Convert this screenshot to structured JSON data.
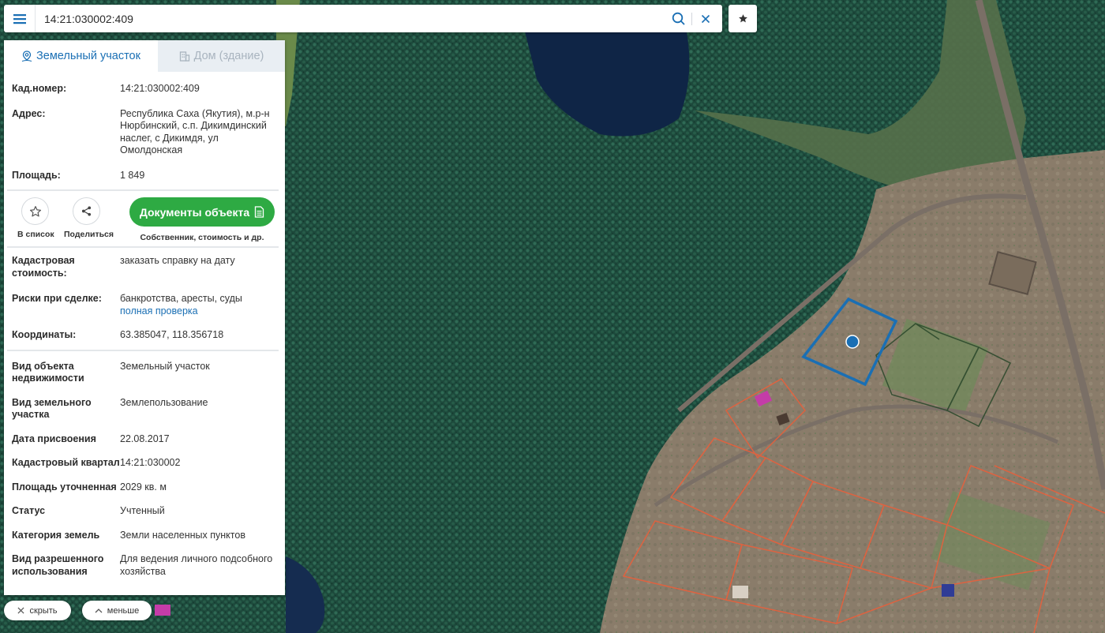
{
  "search": {
    "value": "14:21:030002:409",
    "placeholder": ""
  },
  "icons": {
    "menu": "hamburger-menu-icon",
    "search": "search-icon",
    "clear": "close-icon",
    "favorite": "star-icon",
    "tab_land": "location-pin-icon",
    "tab_house": "building-icon",
    "add_list": "star-outline-icon",
    "share": "share-icon",
    "documents": "document-icon"
  },
  "colors": {
    "accent": "#1a6fb4",
    "green_button": "#2eaa43",
    "parcel_outline": "#1a6fb4",
    "neighbor_outline": "#e8603c"
  },
  "tabs": [
    {
      "label": "Земельный участок",
      "active": true
    },
    {
      "label": "Дом (здание)",
      "active": false
    }
  ],
  "info": {
    "cad_number": {
      "label": "Кад.номер:",
      "value": "14:21:030002:409"
    },
    "address": {
      "label": "Адрес:",
      "value": "Республика Саха (Якутия), м.р-н Нюрбинский, с.п. Дикимдинский наслег, с Дикимдя, ул Омолдонская"
    },
    "area": {
      "label": "Площадь:",
      "value": "1 849"
    }
  },
  "actions": {
    "add_list": "В список",
    "share": "Поделиться",
    "documents": "Документы объекта",
    "documents_sub": "Собственник, стоимость и др."
  },
  "details": {
    "cad_cost": {
      "label": "Кадастровая стоимость:",
      "value": "заказать справку на дату"
    },
    "risks": {
      "label": "Риски при сделке:",
      "value": "банкротства, аресты, суды",
      "link": "полная проверка"
    },
    "coords": {
      "label": "Координаты:",
      "value": "63.385047, 118.356718"
    }
  },
  "properties": [
    {
      "label": "Вид объекта недвижимости",
      "value": "Земельный участок"
    },
    {
      "label": "Вид земельного участка",
      "value": "Землепользование"
    },
    {
      "label": "Дата присвоения",
      "value": "22.08.2017"
    },
    {
      "label": "Кадастровый квартал",
      "value": "14:21:030002"
    },
    {
      "label": "Площадь уточненная",
      "value": "2029 кв. м"
    },
    {
      "label": "Статус",
      "value": "Учтенный"
    },
    {
      "label": "Категория земель",
      "value": "Земли населенных пунктов"
    },
    {
      "label": "Вид разрешенного использования",
      "value": "Для ведения личного подсобного хозяйства"
    }
  ],
  "bottom": {
    "hide": "скрыть",
    "less": "меньше"
  }
}
